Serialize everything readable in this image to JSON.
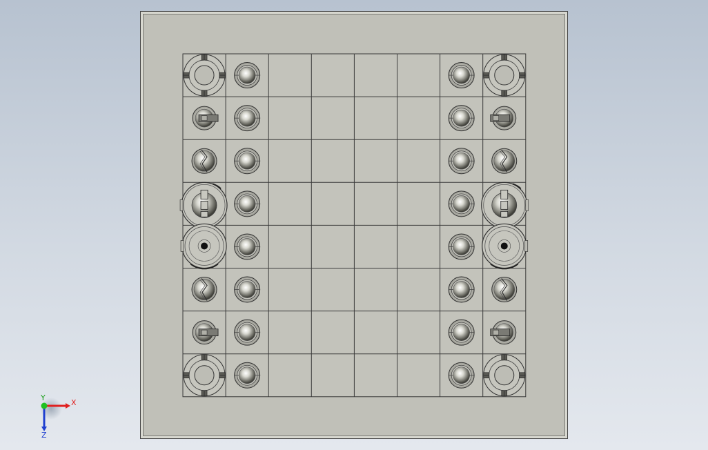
{
  "viewport": {
    "background_top": "#b7c2d0",
    "background_bottom": "#e4e8ee"
  },
  "board": {
    "rows": 8,
    "cols": 8,
    "square_color": "#c3c3bb",
    "line_color": "#3a3a3a"
  },
  "pieces": {
    "left": [
      "rook",
      "knight",
      "bishop",
      "queen",
      "king",
      "bishop",
      "knight",
      "rook"
    ],
    "right": [
      "rook",
      "knight",
      "bishop",
      "queen",
      "king",
      "bishop",
      "knight",
      "rook"
    ],
    "pawn_columns": [
      1,
      6
    ],
    "piece_columns": [
      0,
      7
    ]
  },
  "triad": {
    "x_label": "X",
    "y_label": "Y",
    "z_label": "Z",
    "x_color": "#e02020",
    "y_color": "#20c020",
    "z_color": "#2040d0"
  }
}
